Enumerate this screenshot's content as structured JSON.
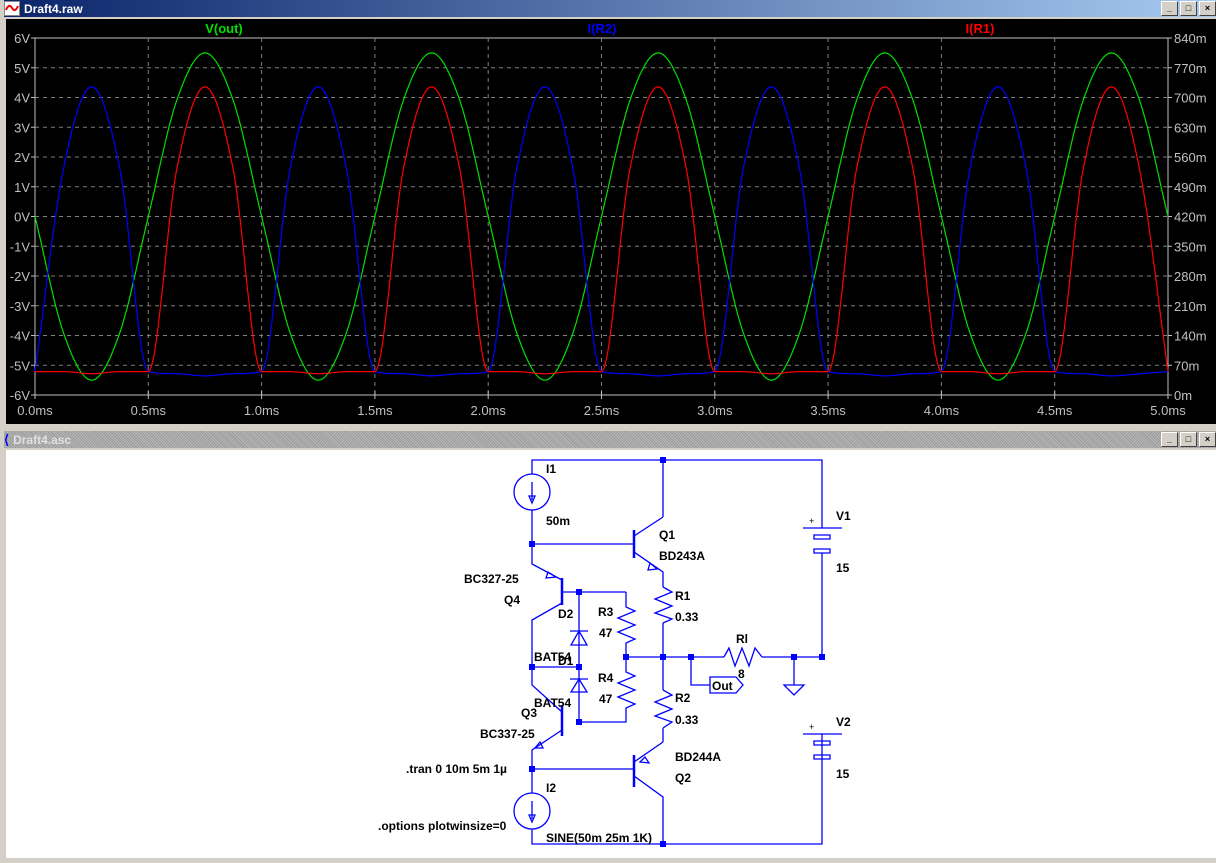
{
  "plot_window": {
    "title": "Draft4.raw",
    "icon": "waveform-icon"
  },
  "schematic_window": {
    "title": "Draft4.asc",
    "icon": "transistor-icon"
  },
  "window_buttons": {
    "minimize": "_",
    "maximize": "□",
    "close": "×"
  },
  "chart_data": {
    "type": "line",
    "x_ticks": [
      "0.0ms",
      "0.5ms",
      "1.0ms",
      "1.5ms",
      "2.0ms",
      "2.5ms",
      "3.0ms",
      "3.5ms",
      "4.0ms",
      "4.5ms",
      "5.0ms"
    ],
    "y_left_ticks": [
      "6V",
      "5V",
      "4V",
      "3V",
      "2V",
      "1V",
      "0V",
      "-1V",
      "-2V",
      "-3V",
      "-4V",
      "-5V",
      "-6V"
    ],
    "y_right_ticks": [
      "840m",
      "770m",
      "700m",
      "630m",
      "560m",
      "490m",
      "420m",
      "350m",
      "280m",
      "210m",
      "140m",
      "70m",
      "0m"
    ],
    "xlim_ms": [
      0,
      5
    ],
    "ylim_left_V": [
      -6,
      6
    ],
    "ylim_right_mA": [
      0,
      840
    ],
    "grid": true,
    "x_ms": [
      0,
      0.125,
      0.25,
      0.375,
      0.5,
      0.625,
      0.75,
      0.875,
      1,
      1.125,
      1.25,
      1.375,
      1.5,
      1.625,
      1.75,
      1.875,
      2,
      2.125,
      2.25,
      2.375,
      2.5,
      2.625,
      2.75,
      2.875,
      3,
      3.125,
      3.25,
      3.375,
      3.5,
      3.625,
      3.75,
      3.875,
      4,
      4.125,
      4.25,
      4.375,
      4.5,
      4.625,
      4.75,
      4.875,
      5
    ],
    "series": [
      {
        "name": "V(out)",
        "axis": "left",
        "color": "#00e000",
        "values": [
          0,
          -3.89,
          -5.5,
          -3.89,
          0,
          3.89,
          5.5,
          3.89,
          0,
          -3.89,
          -5.5,
          -3.89,
          0,
          3.89,
          5.5,
          3.89,
          0,
          -3.89,
          -5.5,
          -3.89,
          0,
          3.89,
          5.5,
          3.89,
          0,
          -3.89,
          -5.5,
          -3.89,
          0,
          3.89,
          5.5,
          3.89,
          0,
          -3.89,
          -5.5,
          -3.89,
          0,
          3.89,
          5.5,
          3.89,
          0
        ]
      },
      {
        "name": "I(R2)",
        "axis": "right",
        "color": "#0000ff",
        "values": [
          55,
          530,
          725,
          530,
          55,
          50,
          45,
          50,
          55,
          530,
          725,
          530,
          55,
          50,
          45,
          50,
          55,
          530,
          725,
          530,
          55,
          50,
          45,
          50,
          55,
          530,
          725,
          530,
          55,
          50,
          45,
          50,
          55,
          530,
          725,
          530,
          55,
          50,
          45,
          50,
          55
        ]
      },
      {
        "name": "I(R1)",
        "axis": "right",
        "color": "#ff0000",
        "values": [
          55,
          55,
          50,
          55,
          55,
          530,
          725,
          530,
          55,
          55,
          50,
          55,
          55,
          530,
          725,
          530,
          55,
          55,
          50,
          55,
          55,
          530,
          725,
          530,
          55,
          55,
          50,
          55,
          55,
          530,
          725,
          530,
          55,
          55,
          50,
          55,
          55,
          530,
          725,
          530,
          55
        ]
      }
    ]
  },
  "schematic": {
    "wire_color": "#0000ff",
    "labels": {
      "i1": "I1",
      "i1_val": "50m",
      "q1": "Q1",
      "q1_val": "BD243A",
      "q4_val": "BC327-25",
      "q4": "Q4",
      "d2": "D2",
      "d2_val": "BAT54",
      "d1": "D1",
      "d1_val": "BAT54",
      "r3": "R3",
      "r3_val": "47",
      "r4": "R4",
      "r4_val": "47",
      "r1": "R1",
      "r1_val": "0.33",
      "r2": "R2",
      "r2_val": "0.33",
      "rl": "Rl",
      "rl_val": "8",
      "out": "Out",
      "q3": "Q3",
      "q3_val": "BC337-25",
      "q2_val": "BD244A",
      "q2": "Q2",
      "tran": ".tran 0 10m 5m 1µ",
      "i2": "I2",
      "options": ".options plotwinsize=0",
      "i2_val": "SINE(50m 25m 1K)",
      "v1": "V1",
      "v1_val": "15",
      "v2": "V2",
      "v2_val": "15",
      "plus": "+"
    }
  }
}
